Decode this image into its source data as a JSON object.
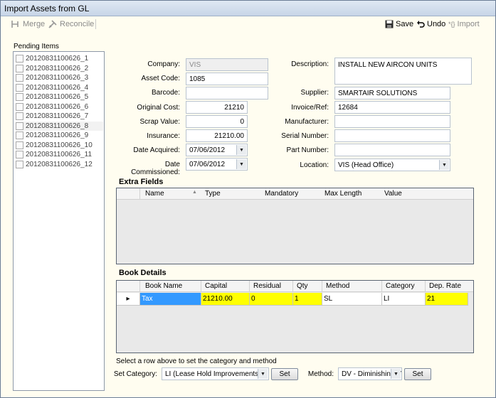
{
  "window": {
    "title": "Import Assets from GL"
  },
  "toolbar": {
    "merge": "Merge",
    "reconcile": "Reconcile",
    "save": "Save",
    "undo": "Undo",
    "import": "Import"
  },
  "pending": {
    "label": "Pending Items",
    "items": [
      "20120831100626_1",
      "20120831100626_2",
      "20120831100626_3",
      "20120831100626_4",
      "20120831100626_5",
      "20120831100626_6",
      "20120831100626_7",
      "20120831100626_8",
      "20120831100626_9",
      "20120831100626_10",
      "20120831100626_11",
      "20120831100626_12"
    ]
  },
  "form": {
    "company_label": "Company:",
    "company": "VIS",
    "asset_code_label": "Asset Code:",
    "asset_code": "1085",
    "barcode_label": "Barcode:",
    "barcode": "",
    "original_cost_label": "Original Cost:",
    "original_cost": "21210",
    "scrap_value_label": "Scrap Value:",
    "scrap_value": "0",
    "insurance_label": "Insurance:",
    "insurance": "21210.00",
    "date_acquired_label": "Date Acquired:",
    "date_acquired": "07/06/2012",
    "date_commissioned_label": "Date Commissioned:",
    "date_commissioned": "07/06/2012",
    "description_label": "Description:",
    "description": "INSTALL NEW AIRCON UNITS",
    "supplier_label": "Supplier:",
    "supplier": "SMARTAIR SOLUTIONS",
    "invoice_label": "Invoice/Ref:",
    "invoice": "12684",
    "manufacturer_label": "Manufacturer:",
    "manufacturer": "",
    "serial_label": "Serial Number:",
    "serial": "",
    "part_label": "Part Number:",
    "part": "",
    "location_label": "Location:",
    "location": "VIS (Head Office)"
  },
  "extra_fields": {
    "title": "Extra Fields",
    "columns": [
      "Name",
      "Type",
      "Mandatory",
      "Max Length",
      "Value"
    ]
  },
  "book_details": {
    "title": "Book Details",
    "columns": [
      "Book Name",
      "Capital",
      "Residual",
      "Qty",
      "Method",
      "Category",
      "Dep. Rate"
    ],
    "row": {
      "book_name": "Tax",
      "capital": "21210.00",
      "residual": "0",
      "qty": "1",
      "method": "SL",
      "category": "LI",
      "dep_rate": "21"
    }
  },
  "footer": {
    "hint": "Select a row above to set the category and method",
    "set_category_label": "Set Category:",
    "category_value": "LI (Lease Hold Improvements)",
    "set1": "Set",
    "method_label": "Method:",
    "method_value": "DV - Diminishing V",
    "set2": "Set"
  }
}
